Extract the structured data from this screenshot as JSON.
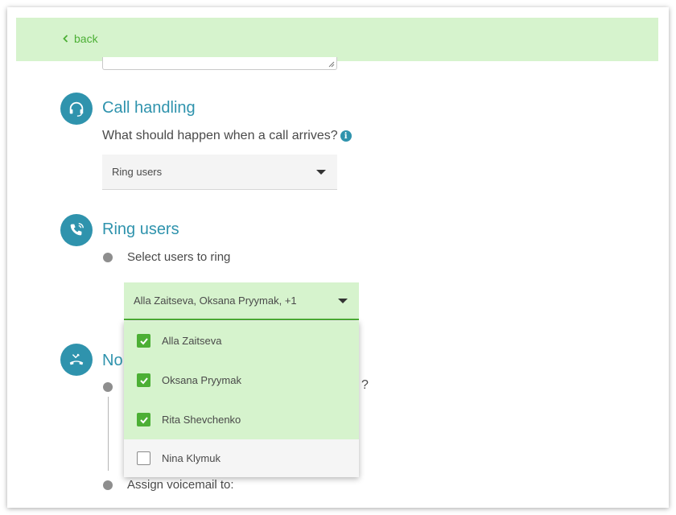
{
  "nav": {
    "back_label": "back"
  },
  "call_handling": {
    "title": "Call handling",
    "question": "What should happen when a call arrives?",
    "select_value": "Ring users"
  },
  "ring_users": {
    "title": "Ring users",
    "step_label": "Select users to ring",
    "select_value": "Alla Zaitseva, Oksana Pryymak, +1",
    "options": [
      {
        "label": "Alla Zaitseva",
        "checked": true
      },
      {
        "label": "Oksana Pryymak",
        "checked": true
      },
      {
        "label": "Rita Shevchenko",
        "checked": true
      },
      {
        "label": "Nina Klymuk",
        "checked": false
      }
    ]
  },
  "no_answer": {
    "title_partial": "No",
    "question_tail": "?",
    "assign_label": "Assign voicemail to:"
  },
  "colors": {
    "accent_teal": "#2f93ad",
    "accent_green": "#4caf35",
    "highlight_green": "#d6f3cd"
  }
}
